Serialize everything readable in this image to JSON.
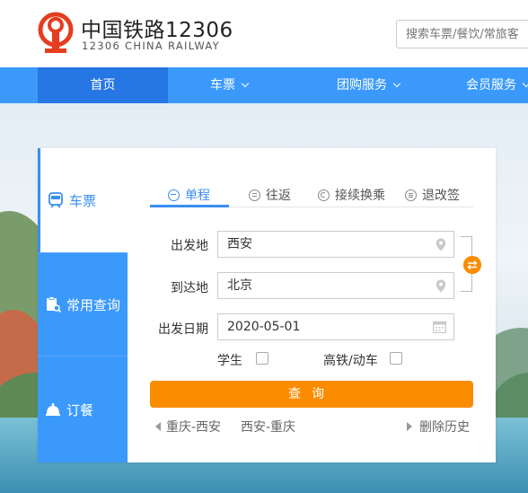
{
  "header": {
    "brand_cn": "中国铁路12306",
    "brand_en": "12306 CHINA RAILWAY",
    "logo_icon": "railway-logo-icon",
    "search_placeholder": "搜索车票/餐饮/常旅客"
  },
  "nav": {
    "items": [
      {
        "label": "首页",
        "active": true,
        "dropdown": false
      },
      {
        "label": "车票",
        "active": false,
        "dropdown": true
      },
      {
        "label": "团购服务",
        "active": false,
        "dropdown": true
      },
      {
        "label": "会员服务",
        "active": false,
        "dropdown": true
      }
    ]
  },
  "sidebar": {
    "tabs": [
      {
        "label": "车票",
        "icon": "train-icon",
        "active": true
      },
      {
        "label": "常用查询",
        "icon": "clipboard-search-icon",
        "active": false
      },
      {
        "label": "订餐",
        "icon": "food-cloche-icon",
        "active": false
      }
    ]
  },
  "trip_tabs": [
    {
      "label": "单程",
      "icon": "minus-circle-icon",
      "active": true
    },
    {
      "label": "往返",
      "icon": "equals-circle-icon",
      "active": false
    },
    {
      "label": "接续换乘",
      "icon": "cycle-circle-icon",
      "active": false
    },
    {
      "label": "退改签",
      "icon": "list-circle-icon",
      "active": false
    }
  ],
  "form": {
    "from_label": "出发地",
    "from_value": "西安",
    "to_label": "到达地",
    "to_value": "北京",
    "date_label": "出发日期",
    "date_value": "2020-05-01",
    "student_label": "学生",
    "student_checked": false,
    "hsr_label": "高铁/动车",
    "hsr_checked": false,
    "query_label": "查询"
  },
  "history": {
    "items": [
      "重庆-西安",
      "西安-重庆"
    ],
    "delete_label": "删除历史"
  },
  "colors": {
    "primary": "#3b99fc",
    "primary_dark": "#2676e3",
    "accent": "#fb8c00",
    "logo_red": "#e53d1f"
  }
}
